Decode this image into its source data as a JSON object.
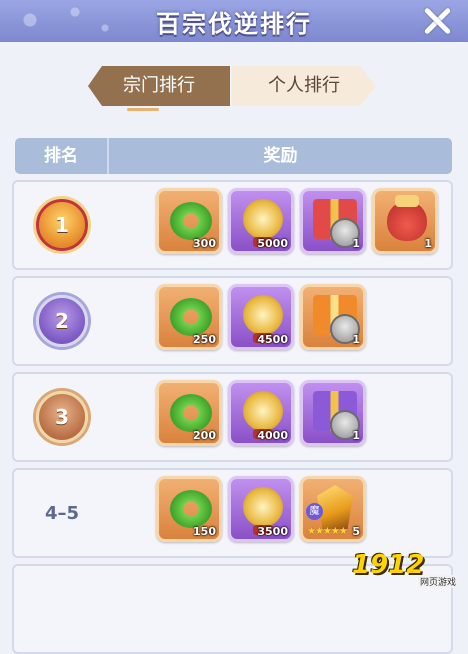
{
  "window": {
    "title": "百宗伐逆排行"
  },
  "tabs": [
    {
      "label": "宗门排行",
      "active": true
    },
    {
      "label": "个人排行",
      "active": false
    }
  ],
  "table": {
    "headers": [
      "排名",
      "奖励"
    ],
    "rows": [
      {
        "rank": "1",
        "medal": "gold",
        "rewards": [
          {
            "kind": "jade-ring",
            "frame": "orange",
            "qty": "300"
          },
          {
            "kind": "gold-coin",
            "frame": "purple",
            "qty": "5000"
          },
          {
            "kind": "gift-box-red",
            "frame": "purple",
            "qty": "1"
          },
          {
            "kind": "lucky-pouch",
            "frame": "orange",
            "qty": "1"
          }
        ]
      },
      {
        "rank": "2",
        "medal": "purple",
        "rewards": [
          {
            "kind": "jade-ring",
            "frame": "orange",
            "qty": "250"
          },
          {
            "kind": "gold-coin",
            "frame": "purple",
            "qty": "4500"
          },
          {
            "kind": "gift-box-orange",
            "frame": "orange",
            "qty": "1"
          }
        ]
      },
      {
        "rank": "3",
        "medal": "bronze",
        "rewards": [
          {
            "kind": "jade-ring",
            "frame": "orange",
            "qty": "200"
          },
          {
            "kind": "gold-coin",
            "frame": "purple",
            "qty": "4000"
          },
          {
            "kind": "gift-box-violet",
            "frame": "purple",
            "qty": "1"
          }
        ]
      },
      {
        "rank": "4–5",
        "medal": "none",
        "rewards": [
          {
            "kind": "jade-ring",
            "frame": "orange",
            "qty": "150"
          },
          {
            "kind": "gold-coin",
            "frame": "purple",
            "qty": "3500"
          },
          {
            "kind": "magic-shard",
            "frame": "orange",
            "qty": "5",
            "badge": "魔",
            "stars": 5
          }
        ]
      }
    ]
  },
  "watermark": {
    "text": "1912",
    "subtext": "网页游戏"
  },
  "colors": {
    "title_bar": "#8a96dd",
    "active_tab": "#93714f",
    "header": "#a9bcd9"
  }
}
